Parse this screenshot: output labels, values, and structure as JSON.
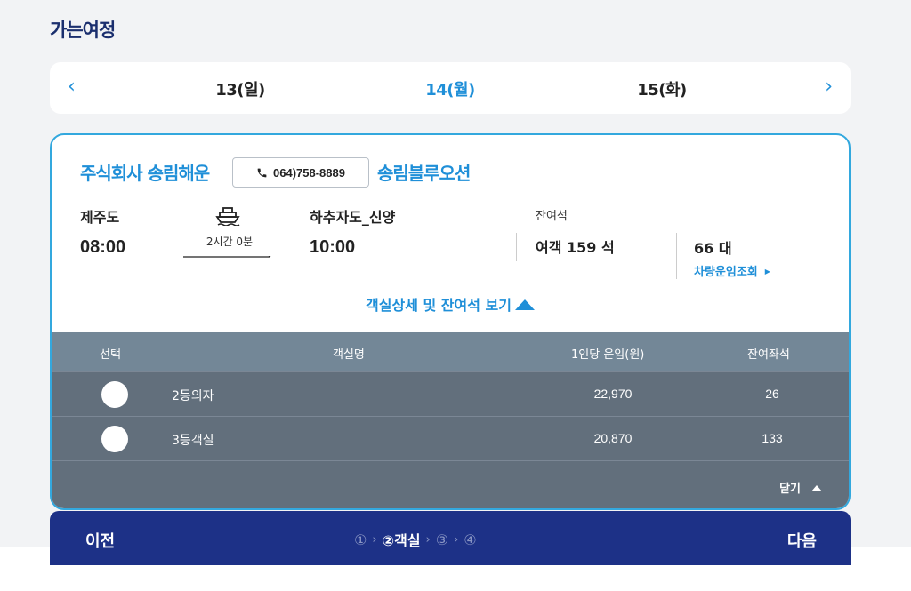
{
  "section_title": "가는여정",
  "date_bar": {
    "prev_icon": "‹",
    "next_icon": "›",
    "dates": [
      "13(일)",
      "14(월)",
      "15(화)"
    ],
    "selected_index": 1
  },
  "card": {
    "company": "주식회사 송림해운",
    "phone": "064)758-8889",
    "ship_name": "송림블루오션",
    "departure": {
      "port": "제주도",
      "time": "08:00"
    },
    "duration": "2시간 0분",
    "arrival": {
      "port": "하추자도_신양",
      "time": "10:00"
    },
    "remaining_label": "잔여석",
    "passenger_seats": "여객 159 석",
    "vehicles": "66 대",
    "vehicle_fare_link": "차량운임조회",
    "detail_toggle": "객실상세 및 잔여석 보기"
  },
  "table": {
    "headers": {
      "select": "선택",
      "room": "객실명",
      "fare": "1인당 운임(원)",
      "remaining": "잔여좌석"
    },
    "rows": [
      {
        "name": "2등의자",
        "fare": "22,970",
        "remaining": "26"
      },
      {
        "name": "3등객실",
        "fare": "20,870",
        "remaining": "133"
      }
    ],
    "close_label": "닫기"
  },
  "bottom_bar": {
    "prev": "이전",
    "next": "다음",
    "steps": [
      "①",
      "②객실",
      "③",
      "④"
    ],
    "active_step": 1,
    "step_sep": "›"
  },
  "colors": {
    "accent": "#1f8fd8",
    "navy": "#1d3187",
    "table_bg": "#626f7c",
    "table_header": "#738797"
  }
}
